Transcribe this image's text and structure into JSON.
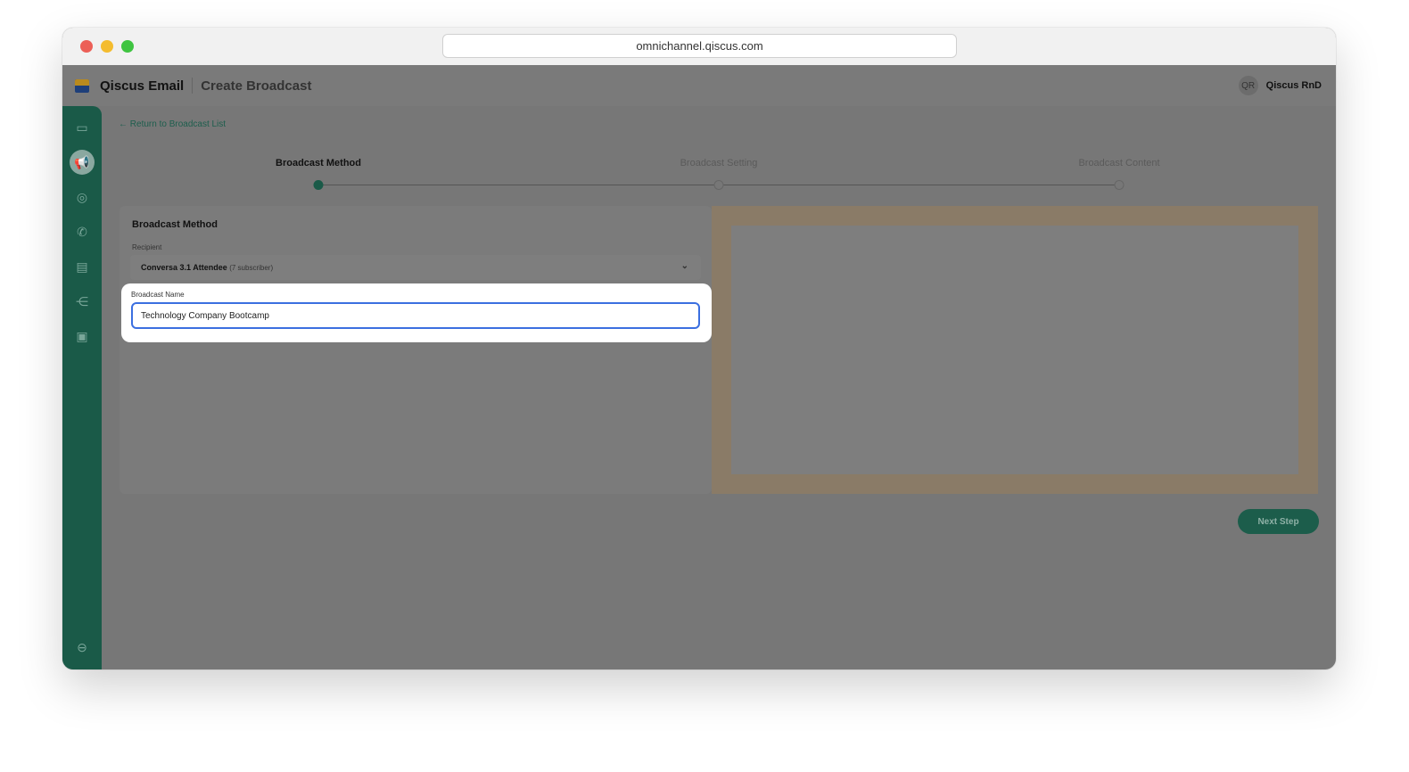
{
  "browser": {
    "url": "omnichannel.qiscus.com"
  },
  "header": {
    "app_name": "Qiscus Email",
    "page_title": "Create Broadcast",
    "user_initials": "QR",
    "user_name": "Qiscus RnD"
  },
  "back_link": "Return to Broadcast List",
  "steps": [
    {
      "label": "Broadcast Method",
      "active": true
    },
    {
      "label": "Broadcast Setting",
      "active": false
    },
    {
      "label": "Broadcast Content",
      "active": false
    }
  ],
  "form": {
    "title": "Broadcast Method",
    "recipient_label": "Recipient",
    "recipient_value": "Conversa 3.1 Attendee",
    "recipient_count": "(7 subscriber)",
    "name_label": "Broadcast Name",
    "name_value": "Technology Company Bootcamp"
  },
  "next_button": "Next Step",
  "colors": {
    "brand": "#1a5a48",
    "focus": "#3b6fe0"
  }
}
